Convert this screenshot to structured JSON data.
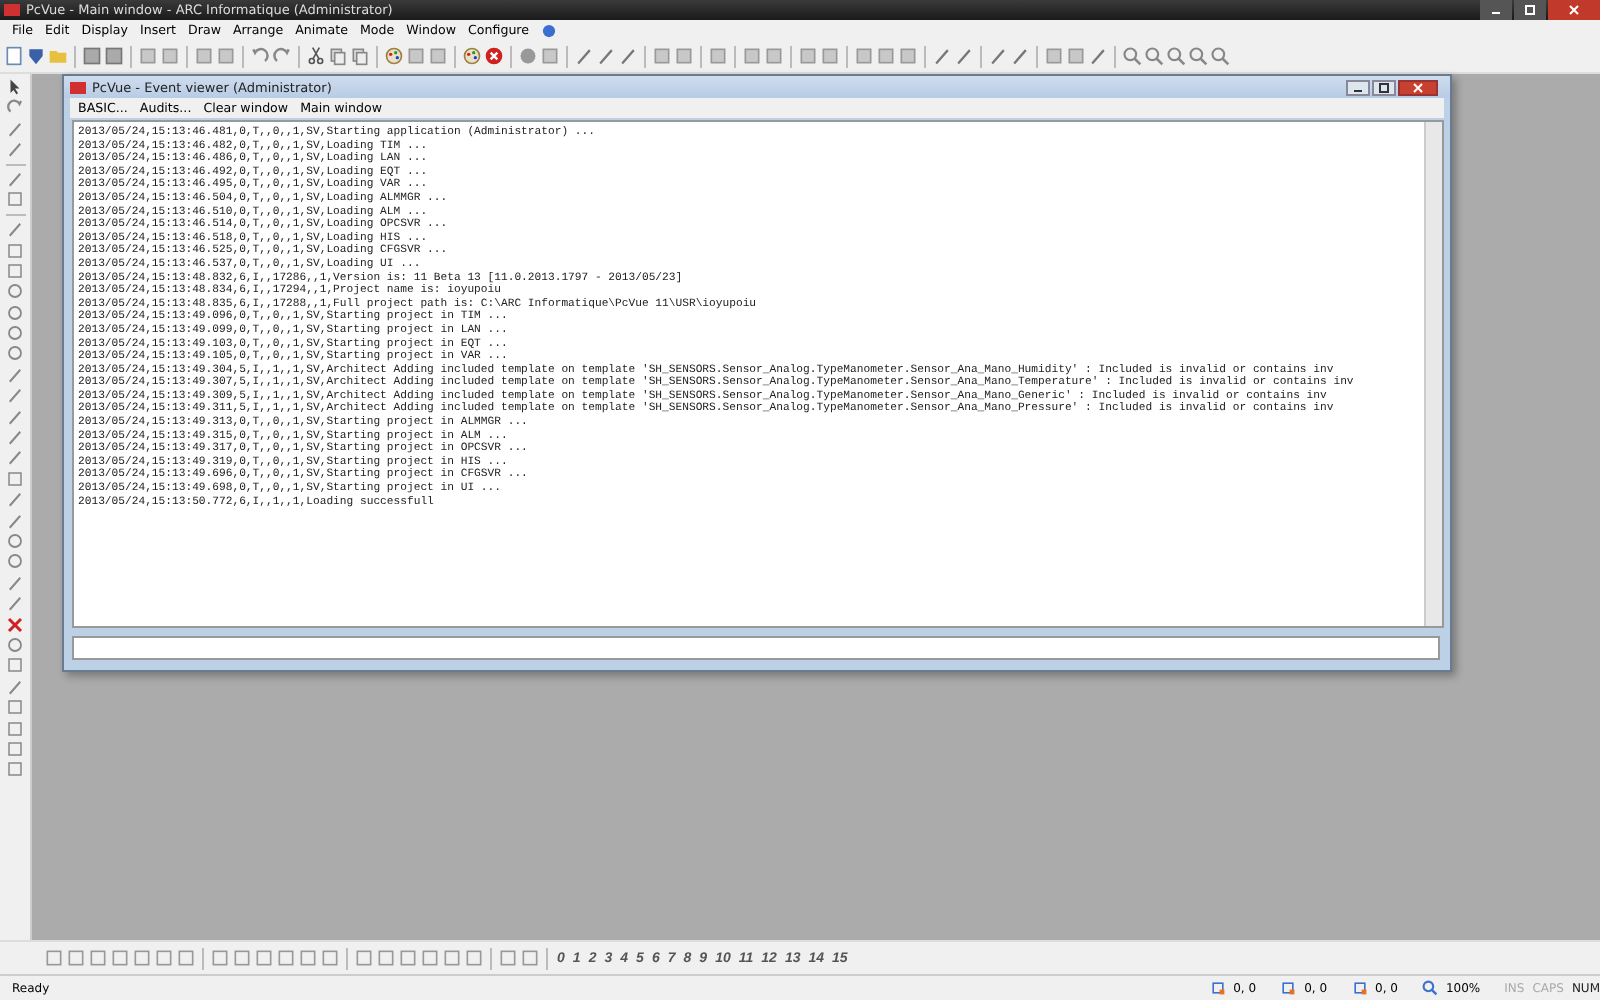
{
  "window": {
    "title": "PcVue - Main window - ARC Informatique (Administrator)"
  },
  "menu": [
    "File",
    "Edit",
    "Display",
    "Insert",
    "Draw",
    "Arrange",
    "Animate",
    "Mode",
    "Window",
    "Configure"
  ],
  "event_viewer": {
    "title": "PcVue - Event viewer (Administrator)",
    "menu": [
      "BASIC...",
      "Audits...",
      "Clear window",
      "Main window"
    ],
    "log": [
      "2013/05/24,15:13:46.481,0,T,,0,,1,SV,Starting application (Administrator) ...",
      "2013/05/24,15:13:46.482,0,T,,0,,1,SV,Loading TIM ...",
      "2013/05/24,15:13:46.486,0,T,,0,,1,SV,Loading LAN ...",
      "2013/05/24,15:13:46.492,0,T,,0,,1,SV,Loading EQT ...",
      "2013/05/24,15:13:46.495,0,T,,0,,1,SV,Loading VAR ...",
      "2013/05/24,15:13:46.504,0,T,,0,,1,SV,Loading ALMMGR ...",
      "2013/05/24,15:13:46.510,0,T,,0,,1,SV,Loading ALM ...",
      "2013/05/24,15:13:46.514,0,T,,0,,1,SV,Loading OPCSVR ...",
      "2013/05/24,15:13:46.518,0,T,,0,,1,SV,Loading HIS ...",
      "2013/05/24,15:13:46.525,0,T,,0,,1,SV,Loading CFGSVR ...",
      "2013/05/24,15:13:46.537,0,T,,0,,1,SV,Loading UI ...",
      "2013/05/24,15:13:48.832,6,I,,17286,,1,Version is: 11 Beta 13 [11.0.2013.1797 - 2013/05/23]",
      "2013/05/24,15:13:48.834,6,I,,17294,,1,Project name is: ioyupoiu",
      "2013/05/24,15:13:48.835,6,I,,17288,,1,Full project path is: C:\\ARC Informatique\\PcVue 11\\USR\\ioyupoiu",
      "2013/05/24,15:13:49.096,0,T,,0,,1,SV,Starting project in TIM ...",
      "2013/05/24,15:13:49.099,0,T,,0,,1,SV,Starting project in LAN ...",
      "2013/05/24,15:13:49.103,0,T,,0,,1,SV,Starting project in EQT ...",
      "2013/05/24,15:13:49.105,0,T,,0,,1,SV,Starting project in VAR ...",
      "2013/05/24,15:13:49.304,5,I,,1,,1,SV,Architect Adding included template on template 'SH_SENSORS.Sensor_Analog.TypeManometer.Sensor_Ana_Mano_Humidity' : Included is invalid or contains inv",
      "2013/05/24,15:13:49.307,5,I,,1,,1,SV,Architect Adding included template on template 'SH_SENSORS.Sensor_Analog.TypeManometer.Sensor_Ana_Mano_Temperature' : Included is invalid or contains inv",
      "2013/05/24,15:13:49.309,5,I,,1,,1,SV,Architect Adding included template on template 'SH_SENSORS.Sensor_Analog.TypeManometer.Sensor_Ana_Mano_Generic' : Included is invalid or contains inv",
      "2013/05/24,15:13:49.311,5,I,,1,,1,SV,Architect Adding included template on template 'SH_SENSORS.Sensor_Analog.TypeManometer.Sensor_Ana_Mano_Pressure' : Included is invalid or contains inv",
      "2013/05/24,15:13:49.313,0,T,,0,,1,SV,Starting project in ALMMGR ...",
      "2013/05/24,15:13:49.315,0,T,,0,,1,SV,Starting project in ALM ...",
      "2013/05/24,15:13:49.317,0,T,,0,,1,SV,Starting project in OPCSVR ...",
      "2013/05/24,15:13:49.319,0,T,,0,,1,SV,Starting project in HIS ...",
      "2013/05/24,15:13:49.696,0,T,,0,,1,SV,Starting project in CFGSVR ...",
      "2013/05/24,15:13:49.698,0,T,,0,,1,SV,Starting project in UI ...",
      "2013/05/24,15:13:50.772,6,I,,1,,1,Loading successfull"
    ]
  },
  "layer_buttons": [
    "0",
    "1",
    "2",
    "3",
    "4",
    "5",
    "6",
    "7",
    "8",
    "9",
    "10",
    "11",
    "12",
    "13",
    "14",
    "15"
  ],
  "status_bar": {
    "message": "Ready",
    "coordinates": [
      "0,  0",
      "0,  0",
      "0,  0"
    ],
    "zoom": "100%",
    "indicators": [
      {
        "label": "INS",
        "on": false
      },
      {
        "label": "CAPS",
        "on": false
      },
      {
        "label": "NUM",
        "on": true
      }
    ]
  }
}
